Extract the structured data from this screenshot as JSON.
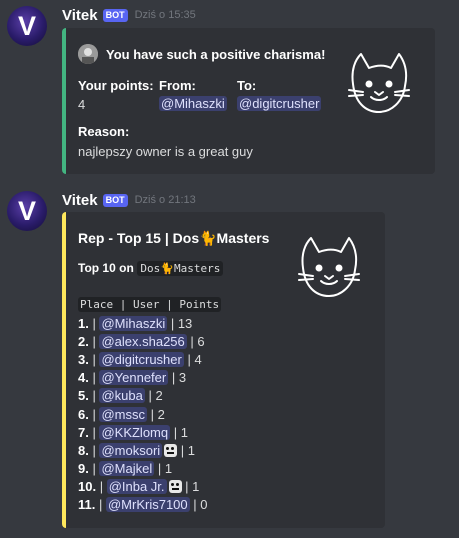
{
  "messages": [
    {
      "username": "Vitek",
      "bot_tag": "BOT",
      "timestamp": "Dziś o 15:35",
      "avatar_letter": "V",
      "embed": {
        "accent": "#43b581",
        "title": "You have such a positive charisma!",
        "fields": [
          {
            "name": "Your points:",
            "value": "4"
          },
          {
            "name": "From:",
            "value": "@Mihaszki"
          },
          {
            "name": "To:",
            "value": "@digitcrusher"
          }
        ],
        "reason_label": "Reason:",
        "reason_value": "najlepszy owner is a great guy"
      }
    },
    {
      "username": "Vitek",
      "bot_tag": "BOT",
      "timestamp": "Dziś o 21:13",
      "avatar_letter": "V",
      "embed": {
        "accent": "#fee75c",
        "title": "Rep - Top 15 | Dos🐈Masters",
        "subtitle_prefix": "Top 10 on",
        "subtitle_server": "Dos🐈Masters",
        "table_header": "Place | User | Points",
        "rows": [
          {
            "rank": "1.",
            "user": "@Mihaszki",
            "points": "13",
            "emoji": false
          },
          {
            "rank": "2.",
            "user": "@alex.sha256",
            "points": "6",
            "emoji": false
          },
          {
            "rank": "3.",
            "user": "@digitcrusher",
            "points": "4",
            "emoji": false
          },
          {
            "rank": "4.",
            "user": "@Yennefer",
            "points": "3",
            "emoji": false
          },
          {
            "rank": "5.",
            "user": "@kuba",
            "points": "2",
            "emoji": false
          },
          {
            "rank": "6.",
            "user": "@mssc",
            "points": "2",
            "emoji": false
          },
          {
            "rank": "7.",
            "user": "@KKZlomq",
            "points": "1",
            "emoji": false
          },
          {
            "rank": "8.",
            "user": "@moksori",
            "points": "1",
            "emoji": true
          },
          {
            "rank": "9.",
            "user": "@Majkel",
            "points": "1",
            "emoji": false
          },
          {
            "rank": "10.",
            "user": "@Inba Jr.",
            "points": "1",
            "emoji": true
          },
          {
            "rank": "11.",
            "user": "@MrKris7100",
            "points": "0",
            "emoji": false
          }
        ]
      }
    }
  ],
  "icons": {
    "thumbnail": "cat-doodle-icon",
    "author_avatar": "author-avatar-icon",
    "emoji": "robot-face-emoji-icon"
  }
}
